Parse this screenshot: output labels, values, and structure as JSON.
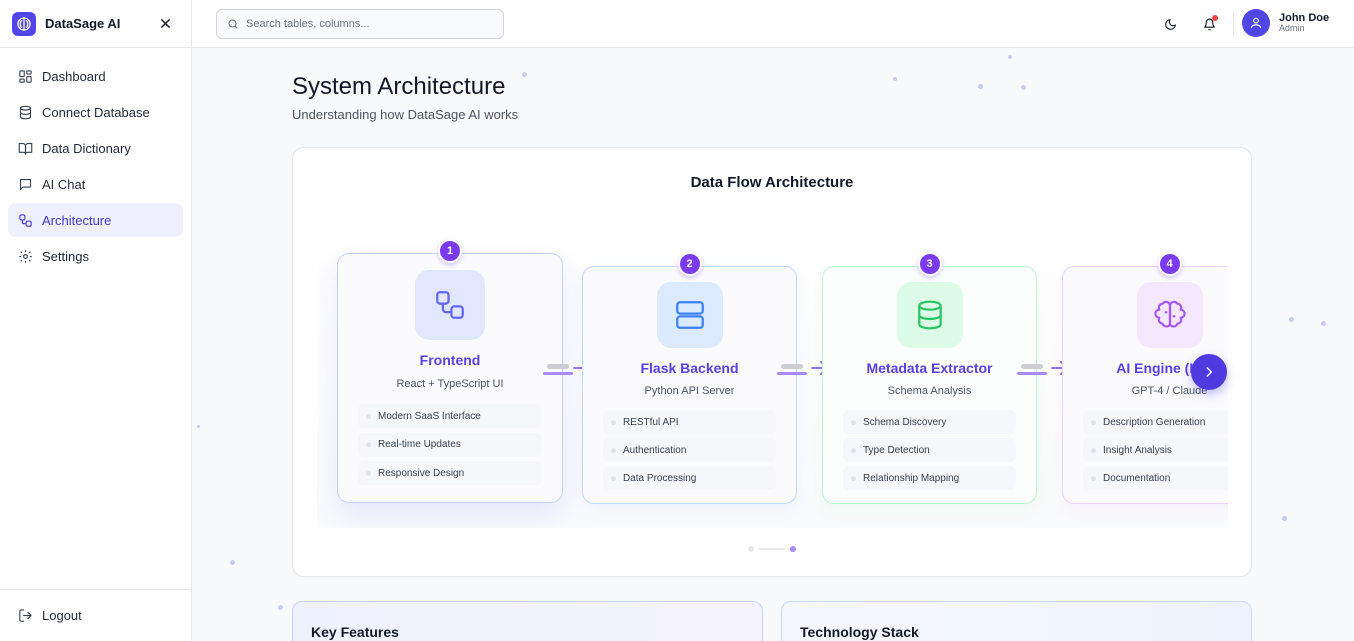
{
  "app": {
    "name": "DataSage AI"
  },
  "sidebar": {
    "items": [
      {
        "label": "Dashboard",
        "icon": "grid-icon",
        "active": false
      },
      {
        "label": "Connect Database",
        "icon": "database-icon",
        "active": false
      },
      {
        "label": "Data Dictionary",
        "icon": "book-icon",
        "active": false
      },
      {
        "label": "AI Chat",
        "icon": "chat-icon",
        "active": false
      },
      {
        "label": "Architecture",
        "icon": "workflow-icon",
        "active": true
      },
      {
        "label": "Settings",
        "icon": "gear-icon",
        "active": false
      }
    ],
    "logout_label": "Logout"
  },
  "header": {
    "search_placeholder": "Search tables, columns...",
    "user": {
      "name": "John Doe",
      "role": "Admin"
    },
    "has_notification": true
  },
  "page": {
    "title": "System Architecture",
    "subtitle": "Understanding how DataSage AI works"
  },
  "flow": {
    "title": "Data Flow Architecture",
    "nodes": [
      {
        "step": "1",
        "name": "Frontend",
        "tech": "React + TypeScript UI",
        "features": [
          "Modern SaaS Interface",
          "Real-time Updates",
          "Responsive Design"
        ],
        "icon": "workflow-icon"
      },
      {
        "step": "2",
        "name": "Flask Backend",
        "tech": "Python API Server",
        "features": [
          "RESTful API",
          "Authentication",
          "Data Processing"
        ],
        "icon": "server-icon"
      },
      {
        "step": "3",
        "name": "Metadata Extractor",
        "tech": "Schema Analysis",
        "features": [
          "Schema Discovery",
          "Type Detection",
          "Relationship Mapping"
        ],
        "icon": "database-icon"
      },
      {
        "step": "4",
        "name": "AI Engine (LLM)",
        "tech": "GPT-4 / Claude",
        "features": [
          "Description Generation",
          "Insight Analysis",
          "Documentation"
        ],
        "icon": "brain-icon"
      }
    ],
    "pages": 2,
    "current_page": 2
  },
  "sections": {
    "key_features_title": "Key Features",
    "tech_stack_title": "Technology Stack"
  },
  "colors": {
    "accent": "#4f46e5",
    "step_badge": "#7c3aed",
    "node_title": "#5b3ee0",
    "notification": "#ef4444"
  }
}
